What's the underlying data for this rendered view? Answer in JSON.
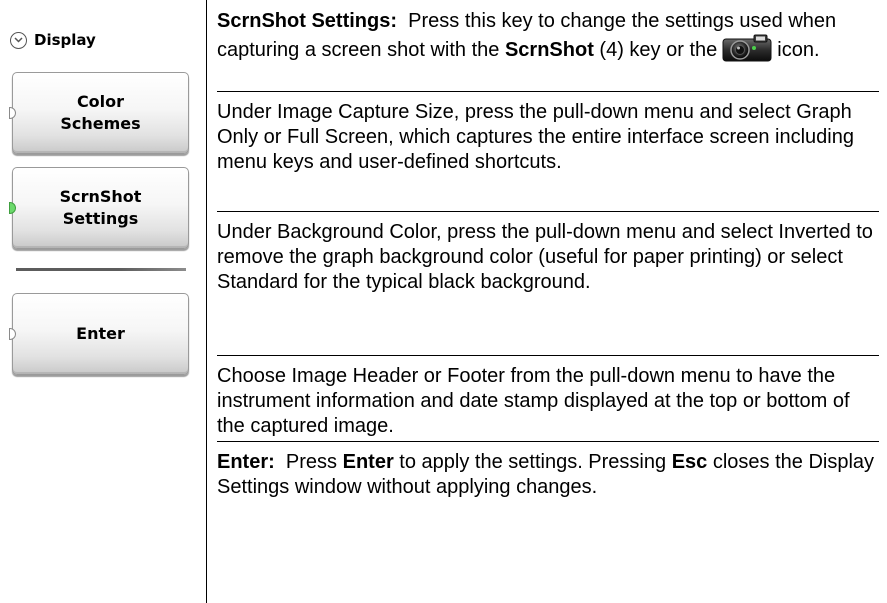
{
  "menu": {
    "title": "Display",
    "keys": [
      {
        "label": "Color\nSchemes",
        "active": false
      },
      {
        "label": "ScrnShot\nSettings",
        "active": true
      },
      {
        "label": "Enter",
        "active": false
      }
    ],
    "indicator_active_color": "#6bd96b"
  },
  "description": {
    "p1": {
      "term": "ScrnShot Settings:",
      "text_a": "Press this key to change the settings used when capturing a screen shot with the",
      "key": "ScrnShot",
      "text_b": "(4) key or the",
      "icon": "camera-icon",
      "text_c": "icon."
    },
    "p2": "Under Image Capture Size, press the pull-down menu and select Graph Only or Full Screen, which captures the entire interface screen including menu keys and user-defined shortcuts.",
    "p3": "Under Background Color, press the pull-down menu and select Inverted to remove the graph background color (useful for paper printing) or select Standard for the typical black background.",
    "p4": "Choose Image Header or Footer from the pull-down menu to have the instrument information and date stamp displayed at the top or bottom of the captured image.",
    "p5": {
      "term": "Enter:",
      "text_a": "Press",
      "key1": "Enter",
      "text_b": "to apply the settings. Pressing",
      "key2": "Esc",
      "text_c": "closes the Display Settings window without applying changes."
    }
  }
}
